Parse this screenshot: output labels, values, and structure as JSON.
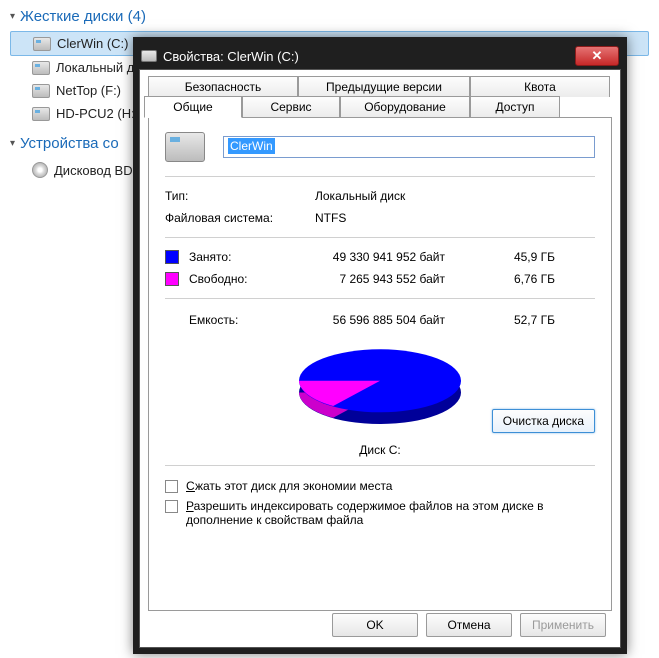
{
  "tree": {
    "hard_drives_header": "Жесткие диски (4)",
    "devices_header": "Устройства со",
    "drives": [
      {
        "label": "ClerWin (C:)",
        "selected": true
      },
      {
        "label": "Локальный д"
      },
      {
        "label": "NetTop (F:)"
      },
      {
        "label": "HD-PCU2 (H:)"
      }
    ],
    "devices": [
      {
        "label": "Дисковод BD"
      }
    ]
  },
  "dialog": {
    "title": "Свойства: ClerWin (C:)",
    "tabs_back": [
      "Безопасность",
      "Предыдущие версии",
      "Квота"
    ],
    "tabs_front": [
      "Общие",
      "Сервис",
      "Оборудование",
      "Доступ"
    ],
    "name_value": "ClerWin",
    "type_label": "Тип:",
    "type_value": "Локальный диск",
    "fs_label": "Файловая система:",
    "fs_value": "NTFS",
    "used_label": "Занято:",
    "used_bytes": "49 330 941 952 байт",
    "used_gb": "45,9 ГБ",
    "free_label": "Свободно:",
    "free_bytes": "7 265 943 552 байт",
    "free_gb": "6,76 ГБ",
    "cap_label": "Емкость:",
    "cap_bytes": "56 596 885 504 байт",
    "cap_gb": "52,7 ГБ",
    "disk_label": "Диск C:",
    "cleanup": "Очистка диска",
    "compress": "Сжать этот диск для экономии места",
    "index": "Разрешить индексировать содержимое файлов на этом диске в дополнение к свойствам файла",
    "ok": "OK",
    "cancel": "Отмена",
    "apply": "Применить"
  },
  "chart_data": {
    "type": "pie",
    "title": "Диск C:",
    "series": [
      {
        "name": "Занято",
        "value": 49330941952,
        "color": "#0000ff"
      },
      {
        "name": "Свободно",
        "value": 7265943552,
        "color": "#ff00ff"
      }
    ]
  }
}
